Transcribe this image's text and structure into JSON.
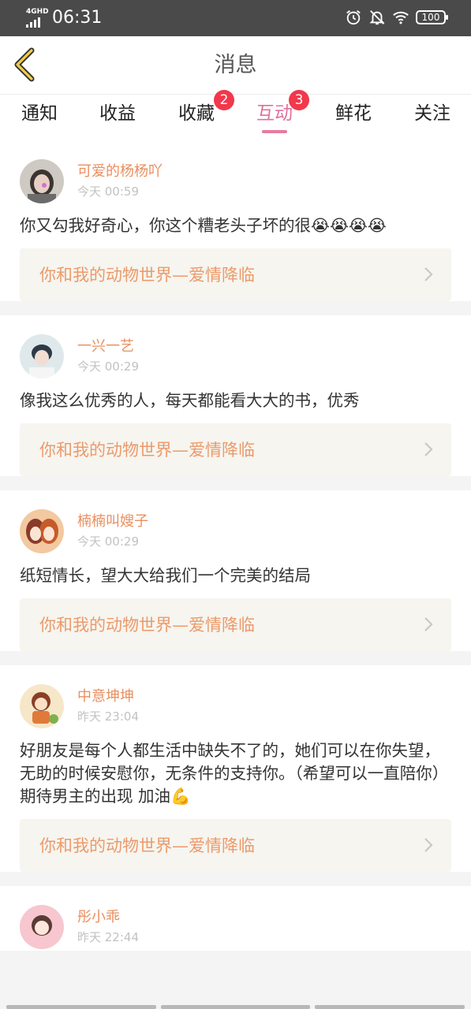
{
  "status_bar": {
    "network": "4GHD",
    "time": "06:31",
    "battery": "100"
  },
  "header": {
    "title": "消息",
    "back_icon": "back-chevron-icon"
  },
  "tabs": [
    {
      "label": "通知",
      "badge": "",
      "active": false
    },
    {
      "label": "收益",
      "badge": "",
      "active": false
    },
    {
      "label": "收藏",
      "badge": "2",
      "active": false
    },
    {
      "label": "互动",
      "badge": "3",
      "active": true
    },
    {
      "label": "鲜花",
      "badge": "",
      "active": false
    },
    {
      "label": "关注",
      "badge": "",
      "active": false
    }
  ],
  "messages": [
    {
      "name": "可爱的杨杨吖",
      "time": "今天 00:59",
      "comment": "你又勾我好奇心，你这个糟老头子坏的很😭😭😭😭",
      "book": "你和我的动物世界—爱情降临"
    },
    {
      "name": "一兴一艺",
      "time": "今天 00:29",
      "comment": "像我这么优秀的人，每天都能看大大的书，优秀",
      "book": "你和我的动物世界—爱情降临"
    },
    {
      "name": "楠楠叫嫂子",
      "time": "今天 00:29",
      "comment": "纸短情长，望大大给我们一个完美的结局",
      "book": "你和我的动物世界—爱情降临"
    },
    {
      "name": "中意坤坤",
      "time": "昨天 23:04",
      "comment": "好朋友是每个人都生活中缺失不了的，她们可以在你失望，无助的时候安慰你，无条件的支持你。（希望可以一直陪你） 期待男主的出现 加油💪",
      "book": "你和我的动物世界—爱情降临"
    },
    {
      "name": "彤小乖",
      "time": "昨天 22:44",
      "comment": "",
      "book": ""
    }
  ],
  "colors": {
    "accent": "#e0709c",
    "badge": "#f2384b",
    "username": "#e98f60",
    "book_link": "#ec9a6b",
    "status_bar": "#4a4a4a"
  }
}
